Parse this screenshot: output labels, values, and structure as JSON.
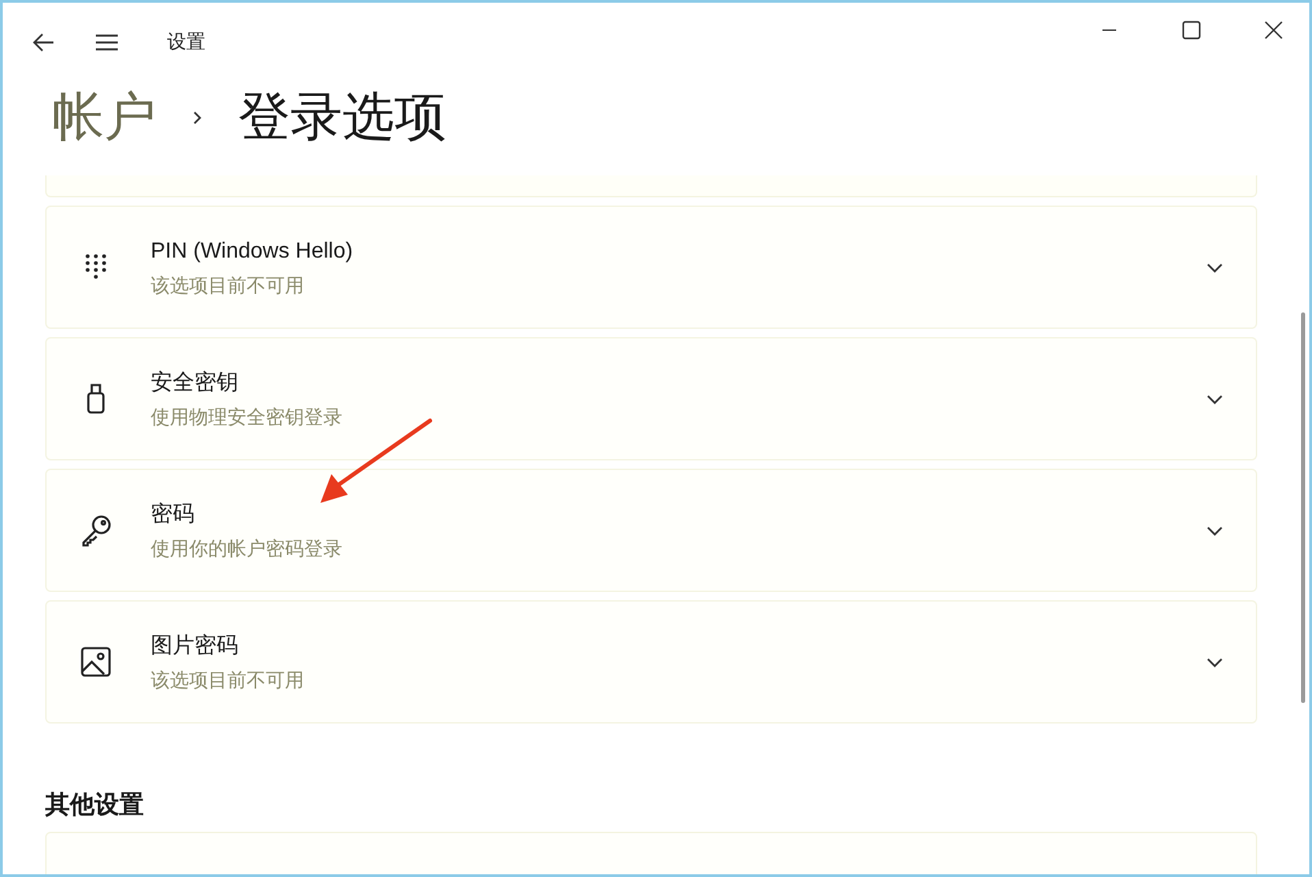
{
  "window": {
    "title": "设置"
  },
  "breadcrumb": {
    "parent": "帐户",
    "current": "登录选项"
  },
  "options": [
    {
      "kind": "pin",
      "title": "PIN (Windows Hello)",
      "subtitle": "该选项目前不可用"
    },
    {
      "kind": "security-key",
      "title": "安全密钥",
      "subtitle": "使用物理安全密钥登录"
    },
    {
      "kind": "password",
      "title": "密码",
      "subtitle": "使用你的帐户密码登录"
    },
    {
      "kind": "picture",
      "title": "图片密码",
      "subtitle": "该选项目前不可用"
    }
  ],
  "other_settings": {
    "heading": "其他设置"
  }
}
